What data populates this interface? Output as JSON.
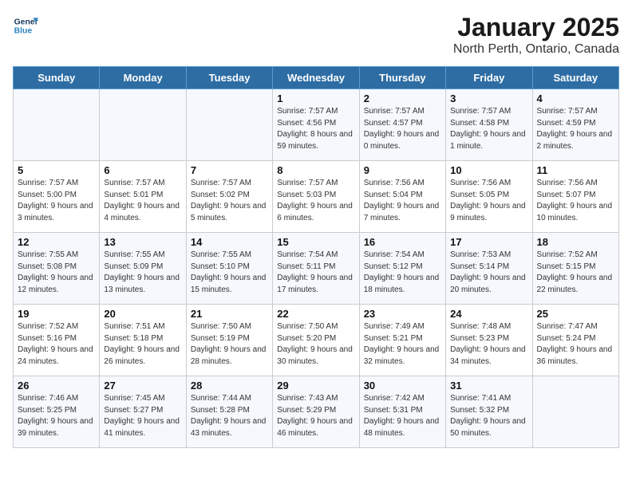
{
  "logo": {
    "line1": "General",
    "line2": "Blue"
  },
  "title": "January 2025",
  "subtitle": "North Perth, Ontario, Canada",
  "weekdays": [
    "Sunday",
    "Monday",
    "Tuesday",
    "Wednesday",
    "Thursday",
    "Friday",
    "Saturday"
  ],
  "weeks": [
    [
      {
        "day": "",
        "info": ""
      },
      {
        "day": "",
        "info": ""
      },
      {
        "day": "",
        "info": ""
      },
      {
        "day": "1",
        "info": "Sunrise: 7:57 AM\nSunset: 4:56 PM\nDaylight: 8 hours and 59 minutes."
      },
      {
        "day": "2",
        "info": "Sunrise: 7:57 AM\nSunset: 4:57 PM\nDaylight: 9 hours and 0 minutes."
      },
      {
        "day": "3",
        "info": "Sunrise: 7:57 AM\nSunset: 4:58 PM\nDaylight: 9 hours and 1 minute."
      },
      {
        "day": "4",
        "info": "Sunrise: 7:57 AM\nSunset: 4:59 PM\nDaylight: 9 hours and 2 minutes."
      }
    ],
    [
      {
        "day": "5",
        "info": "Sunrise: 7:57 AM\nSunset: 5:00 PM\nDaylight: 9 hours and 3 minutes."
      },
      {
        "day": "6",
        "info": "Sunrise: 7:57 AM\nSunset: 5:01 PM\nDaylight: 9 hours and 4 minutes."
      },
      {
        "day": "7",
        "info": "Sunrise: 7:57 AM\nSunset: 5:02 PM\nDaylight: 9 hours and 5 minutes."
      },
      {
        "day": "8",
        "info": "Sunrise: 7:57 AM\nSunset: 5:03 PM\nDaylight: 9 hours and 6 minutes."
      },
      {
        "day": "9",
        "info": "Sunrise: 7:56 AM\nSunset: 5:04 PM\nDaylight: 9 hours and 7 minutes."
      },
      {
        "day": "10",
        "info": "Sunrise: 7:56 AM\nSunset: 5:05 PM\nDaylight: 9 hours and 9 minutes."
      },
      {
        "day": "11",
        "info": "Sunrise: 7:56 AM\nSunset: 5:07 PM\nDaylight: 9 hours and 10 minutes."
      }
    ],
    [
      {
        "day": "12",
        "info": "Sunrise: 7:55 AM\nSunset: 5:08 PM\nDaylight: 9 hours and 12 minutes."
      },
      {
        "day": "13",
        "info": "Sunrise: 7:55 AM\nSunset: 5:09 PM\nDaylight: 9 hours and 13 minutes."
      },
      {
        "day": "14",
        "info": "Sunrise: 7:55 AM\nSunset: 5:10 PM\nDaylight: 9 hours and 15 minutes."
      },
      {
        "day": "15",
        "info": "Sunrise: 7:54 AM\nSunset: 5:11 PM\nDaylight: 9 hours and 17 minutes."
      },
      {
        "day": "16",
        "info": "Sunrise: 7:54 AM\nSunset: 5:12 PM\nDaylight: 9 hours and 18 minutes."
      },
      {
        "day": "17",
        "info": "Sunrise: 7:53 AM\nSunset: 5:14 PM\nDaylight: 9 hours and 20 minutes."
      },
      {
        "day": "18",
        "info": "Sunrise: 7:52 AM\nSunset: 5:15 PM\nDaylight: 9 hours and 22 minutes."
      }
    ],
    [
      {
        "day": "19",
        "info": "Sunrise: 7:52 AM\nSunset: 5:16 PM\nDaylight: 9 hours and 24 minutes."
      },
      {
        "day": "20",
        "info": "Sunrise: 7:51 AM\nSunset: 5:18 PM\nDaylight: 9 hours and 26 minutes."
      },
      {
        "day": "21",
        "info": "Sunrise: 7:50 AM\nSunset: 5:19 PM\nDaylight: 9 hours and 28 minutes."
      },
      {
        "day": "22",
        "info": "Sunrise: 7:50 AM\nSunset: 5:20 PM\nDaylight: 9 hours and 30 minutes."
      },
      {
        "day": "23",
        "info": "Sunrise: 7:49 AM\nSunset: 5:21 PM\nDaylight: 9 hours and 32 minutes."
      },
      {
        "day": "24",
        "info": "Sunrise: 7:48 AM\nSunset: 5:23 PM\nDaylight: 9 hours and 34 minutes."
      },
      {
        "day": "25",
        "info": "Sunrise: 7:47 AM\nSunset: 5:24 PM\nDaylight: 9 hours and 36 minutes."
      }
    ],
    [
      {
        "day": "26",
        "info": "Sunrise: 7:46 AM\nSunset: 5:25 PM\nDaylight: 9 hours and 39 minutes."
      },
      {
        "day": "27",
        "info": "Sunrise: 7:45 AM\nSunset: 5:27 PM\nDaylight: 9 hours and 41 minutes."
      },
      {
        "day": "28",
        "info": "Sunrise: 7:44 AM\nSunset: 5:28 PM\nDaylight: 9 hours and 43 minutes."
      },
      {
        "day": "29",
        "info": "Sunrise: 7:43 AM\nSunset: 5:29 PM\nDaylight: 9 hours and 46 minutes."
      },
      {
        "day": "30",
        "info": "Sunrise: 7:42 AM\nSunset: 5:31 PM\nDaylight: 9 hours and 48 minutes."
      },
      {
        "day": "31",
        "info": "Sunrise: 7:41 AM\nSunset: 5:32 PM\nDaylight: 9 hours and 50 minutes."
      },
      {
        "day": "",
        "info": ""
      }
    ]
  ]
}
